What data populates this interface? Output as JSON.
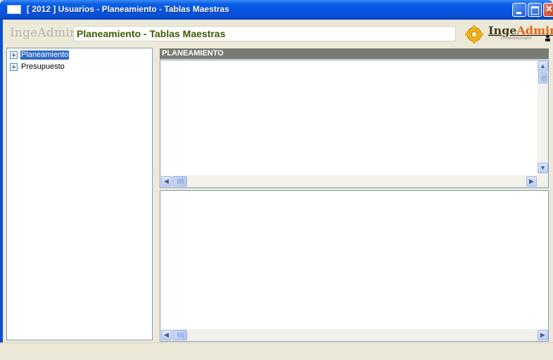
{
  "window": {
    "title": "[ 2012 ] Usuarios - Planeamiento - Tablas Maestras",
    "icon": "app-window-icon"
  },
  "header": {
    "logo_text": "IngeAdmin",
    "section_title": "Planeamiento - Tablas Maestras",
    "brand": {
      "name_part1": "Inge",
      "name_part2": "Admin",
      "subtitle": "El Administrador",
      "colors": {
        "inge": "#4a3b1b",
        "admin": "#e3640f"
      }
    }
  },
  "tree": {
    "items": [
      {
        "label": "Planeamiento",
        "selected": true
      },
      {
        "label": "Presupuesto",
        "selected": false
      }
    ]
  },
  "panel": {
    "title": "PLANEAMIENTO"
  },
  "colors": {
    "titlebar": "#0554e3",
    "selection": "#316ac5",
    "panel_header": "#7b7b75",
    "header_title": "#3b5b00"
  }
}
